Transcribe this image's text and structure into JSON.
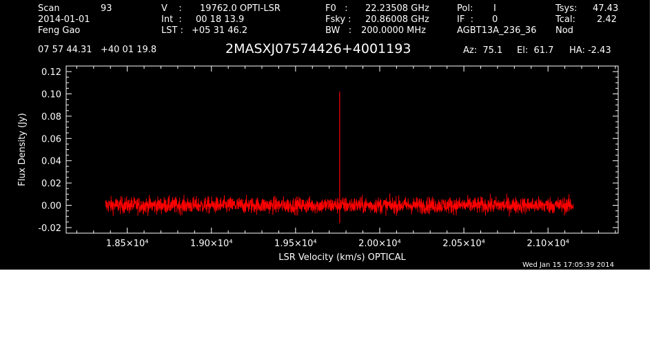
{
  "header": {
    "scan_label": "Scan",
    "scan_value": "93",
    "date": "2014-01-01",
    "observer": "Feng Gao",
    "v_label": "V    :",
    "v_value": "19762.0 OPTI-LSR",
    "int_label": "Int  :",
    "int_value": "00 18 13.9",
    "lst_label": "LST :",
    "lst_value": "+05 31 46.2",
    "f0_label": "F0   :",
    "f0_value": "22.23508 GHz",
    "fsky_label": "Fsky :",
    "fsky_value": "20.86008 GHz",
    "bw_label": "BW   :",
    "bw_value": "200.0000 MHz",
    "pol_label": "Pol:",
    "pol_value": "I",
    "if_label": "IF  :",
    "if_value": "0",
    "project": "AGBT13A_236_36",
    "tsys_label": "Tsys:",
    "tsys_value": "47.43",
    "tcal_label": "Tcal:",
    "tcal_value": "2.42",
    "mode": "Nod",
    "ra_dec": "07 57 44.31   +40 01 19.8",
    "source": "2MASXJ07574426+4001193",
    "az": "Az:  75.1",
    "el": "El:  61.7",
    "ha": "HA: -2.43",
    "timestamp": "Wed Jan 15 17:05:39 2014"
  },
  "chart_data": {
    "type": "line",
    "xlabel": "LSR Velocity (km/s) OPTICAL",
    "ylabel": "Flux Density (Jy)",
    "xlim": [
      18137,
      21417
    ],
    "ylim": [
      -0.025,
      0.125
    ],
    "x_ticks": [
      18500,
      19000,
      19500,
      20000,
      20500,
      21000
    ],
    "x_tick_labels": [
      "1.85×10⁴",
      "1.90×10⁴",
      "1.95×10⁴",
      "2.00×10⁴",
      "2.05×10⁴",
      "2.10×10⁴"
    ],
    "y_ticks": [
      -0.02,
      0.0,
      0.02,
      0.04,
      0.06,
      0.08,
      0.1,
      0.12
    ],
    "y_tick_labels": [
      "-0.02",
      "0.00",
      "0.02",
      "0.04",
      "0.06",
      "0.08",
      "0.10",
      "0.12"
    ],
    "grid": false,
    "series": [
      {
        "color": "#ff0000",
        "x_range": [
          18370,
          21150
        ],
        "baseline": 0.0,
        "noise_rms": 0.005,
        "peak_x": 19762,
        "peak_y": 0.102,
        "peak_min_y": -0.016
      }
    ]
  }
}
